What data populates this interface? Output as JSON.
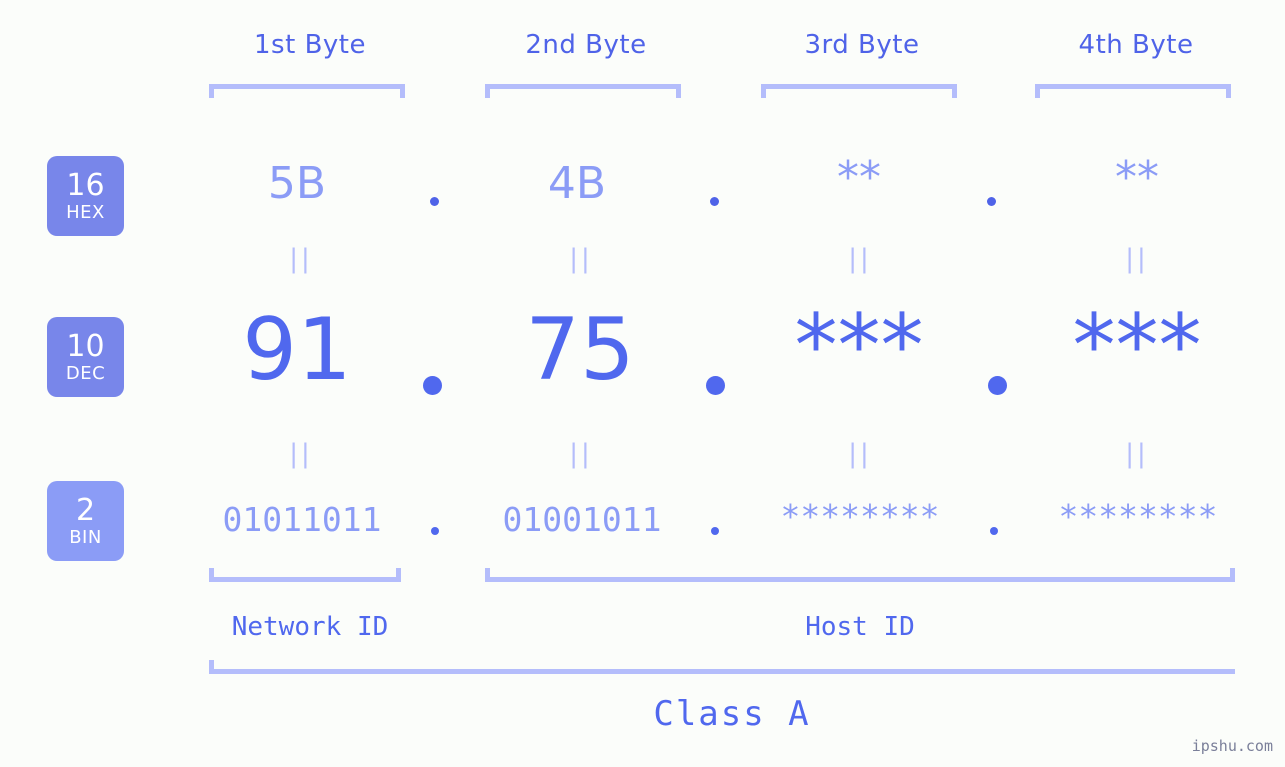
{
  "background_color": "#fbfdfa",
  "accent_colors": {
    "strong": "#5068ee",
    "mid": "#8b9cf6",
    "light": "#b4bdfb",
    "badge": "#7886ea",
    "badge_light": "#8b9cf6"
  },
  "byte_headers": [
    {
      "label": "1st Byte"
    },
    {
      "label": "2nd Byte"
    },
    {
      "label": "3rd Byte"
    },
    {
      "label": "4th Byte"
    }
  ],
  "bases": [
    {
      "number": "16",
      "name": "HEX"
    },
    {
      "number": "10",
      "name": "DEC"
    },
    {
      "number": "2",
      "name": "BIN"
    }
  ],
  "rows": {
    "hex": {
      "values": [
        "5B",
        "4B",
        "**",
        "**"
      ],
      "separator": "."
    },
    "dec": {
      "values": [
        "91",
        "75",
        "***",
        "***"
      ],
      "separator": "."
    },
    "bin": {
      "values": [
        "01011011",
        "01001011",
        "********",
        "********"
      ],
      "separator": "."
    }
  },
  "equals_mark": "||",
  "segments": {
    "network_id": "Network ID",
    "host_id": "Host ID",
    "class": "Class A"
  },
  "watermark": "ipshu.com"
}
